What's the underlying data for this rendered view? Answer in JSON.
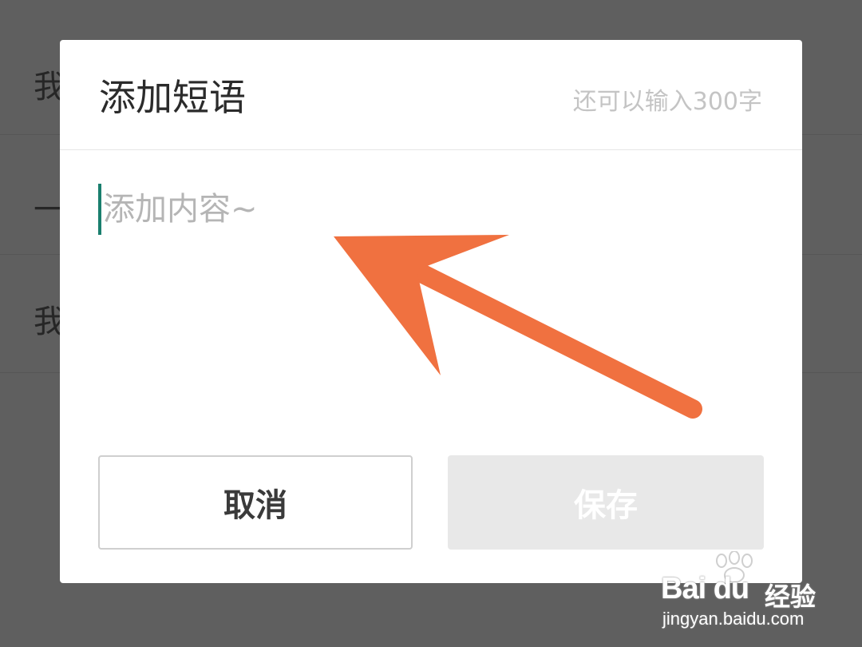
{
  "background": {
    "rows": [
      {
        "text": "我"
      },
      {
        "text": "一"
      },
      {
        "text": "我"
      }
    ]
  },
  "dialog": {
    "title": "添加短语",
    "counter": "还可以输入300字",
    "placeholder": "添加内容~",
    "cancel_label": "取消",
    "save_label": "保存"
  },
  "watermark": {
    "logo": "Bai du",
    "tag": "经验",
    "url": "jingyan.baidu.com"
  },
  "colors": {
    "overlay": "#5f5f5f",
    "caret": "#1a7f6e",
    "arrow": "#f07140",
    "save_disabled_bg": "#e8e8e8"
  },
  "icons": [
    "paw-icon",
    "arrow-annotation"
  ]
}
